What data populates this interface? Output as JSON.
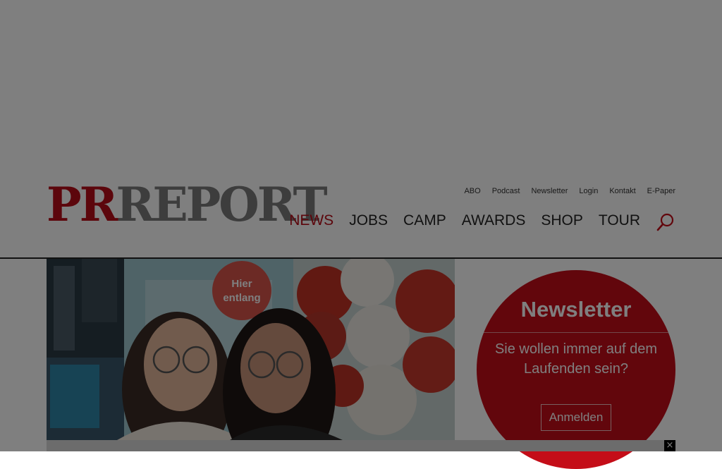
{
  "logo": {
    "part1": "PR",
    "part2": "REPORT"
  },
  "top_links": [
    "ABO",
    "Podcast",
    "Newsletter",
    "Login",
    "Kontakt",
    "E-Paper"
  ],
  "nav": {
    "items": [
      "NEWS",
      "JOBS",
      "CAMP",
      "AWARDS",
      "SHOP",
      "TOUR"
    ],
    "active": "NEWS",
    "search_icon": "search-icon"
  },
  "hero": {
    "sign_text": "Hier entlang"
  },
  "newsletter": {
    "title": "Newsletter",
    "text": "Sie wollen immer auf dem Laufenden sein?",
    "button": "Anmelden"
  },
  "close_label": "×",
  "colors": {
    "brand_red": "#c40d18",
    "logo_grey": "#7a7a7a",
    "overlay": "rgba(0,0,0,0.5)"
  }
}
